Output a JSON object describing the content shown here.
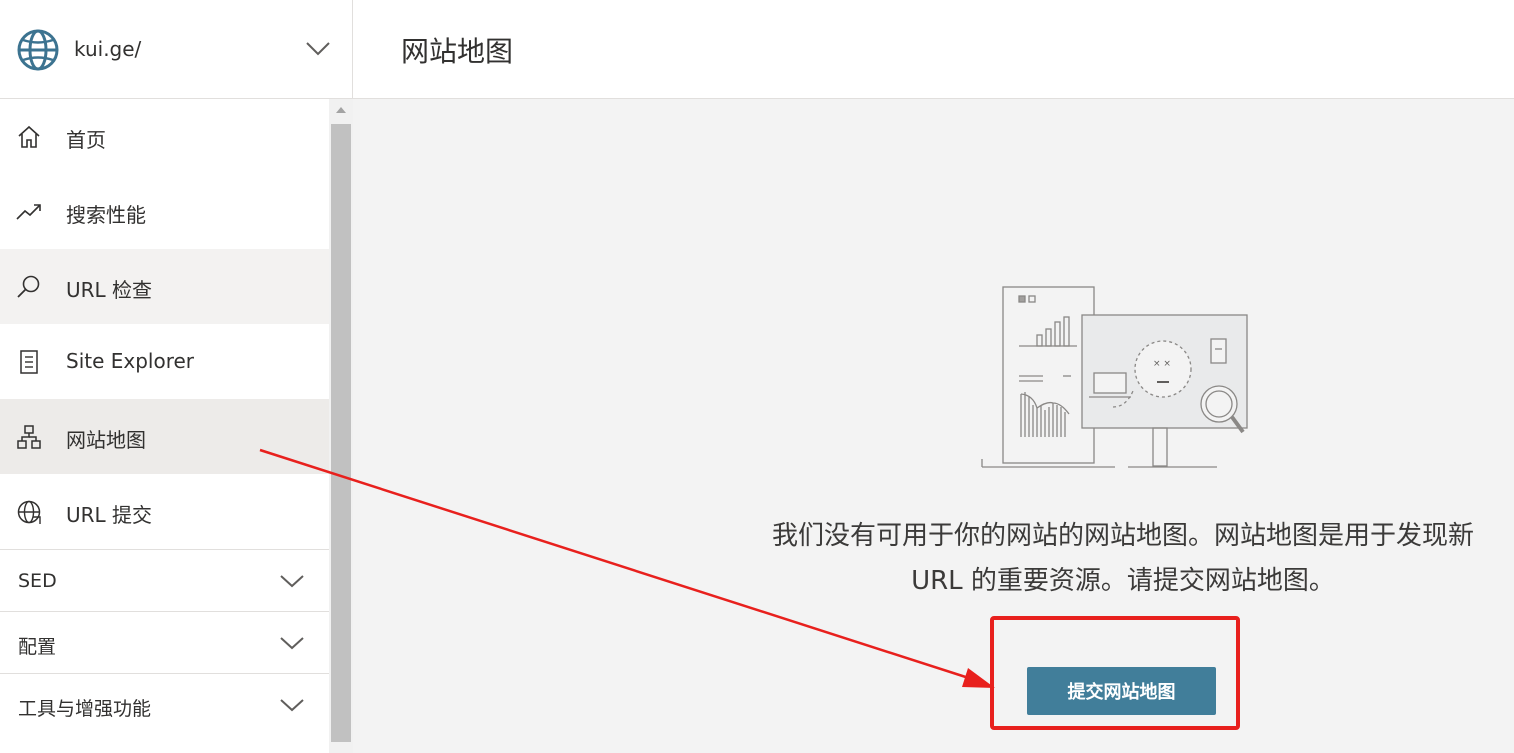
{
  "site": {
    "name": "kui.ge/",
    "icon": "globe-icon"
  },
  "header": {
    "title": "网站地图"
  },
  "nav": {
    "items": [
      {
        "label": "首页",
        "icon": "home-icon"
      },
      {
        "label": "搜索性能",
        "icon": "trend-icon"
      },
      {
        "label": "URL 检查",
        "icon": "search-icon"
      },
      {
        "label": "Site Explorer",
        "icon": "document-list-icon"
      },
      {
        "label": "网站地图",
        "icon": "sitemap-icon",
        "active": true
      },
      {
        "label": "URL 提交",
        "icon": "globe-submit-icon"
      }
    ],
    "groups": [
      {
        "label": "SED"
      },
      {
        "label": "配置"
      },
      {
        "label": "工具与增强功能"
      }
    ]
  },
  "main": {
    "empty_message": "我们没有可用于你的网站的网站地图。网站地图是用于发现新 URL 的重要资源。请提交网站地图。",
    "submit_label": "提交网站地图"
  },
  "colors": {
    "accent_button": "#417e9a",
    "active_nav_bg": "#edebe9",
    "annotation_red": "#e8201d",
    "main_bg": "#f3f3f3"
  }
}
